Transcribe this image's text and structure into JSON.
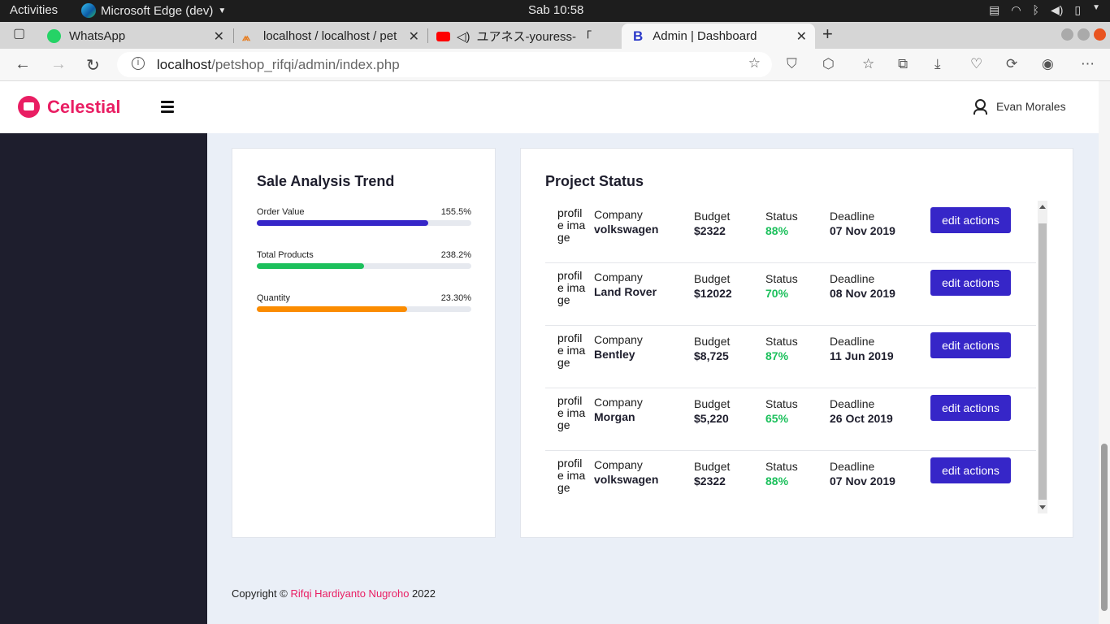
{
  "os": {
    "activities": "Activities",
    "app_name": "Microsoft Edge (dev)",
    "clock": "Sab 10:58"
  },
  "tabs": [
    {
      "title": "WhatsApp",
      "icon": "whatsapp-icon"
    },
    {
      "title": "localhost / localhost / pet",
      "icon": "phpmyadmin-icon"
    },
    {
      "title": "ユアネス-youress- 「",
      "icon": "youtube-icon"
    },
    {
      "title": "Admin | Dashboard",
      "icon": "bootstrap-icon",
      "active": true
    }
  ],
  "address": {
    "host": "localhost",
    "path": "/petshop_rifqi/admin/index.php"
  },
  "header": {
    "brand": "Celestial",
    "user_name": "Evan Morales",
    "brand_color": "#e91e63"
  },
  "sale_analysis": {
    "title": "Sale Analysis Trend",
    "metrics": [
      {
        "label": "Order Value",
        "value": "155.5%",
        "fill": 0.8,
        "color": "#3626c8"
      },
      {
        "label": "Total Products",
        "value": "238.2%",
        "fill": 0.5,
        "color": "#1cc05c"
      },
      {
        "label": "Quantity",
        "value": "23.30%",
        "fill": 0.7,
        "color": "#fb8c00"
      }
    ]
  },
  "project_status": {
    "title": "Project Status",
    "image_alt": "profile image",
    "labels": {
      "company": "Company",
      "budget": "Budget",
      "status": "Status",
      "deadline": "Deadline",
      "action": "edit actions"
    },
    "rows": [
      {
        "company": "volkswagen",
        "budget": "$2322",
        "status": "88%",
        "deadline": "07 Nov 2019"
      },
      {
        "company": "Land Rover",
        "budget": "$12022",
        "status": "70%",
        "deadline": "08 Nov 2019"
      },
      {
        "company": "Bentley",
        "budget": "$8,725",
        "status": "87%",
        "deadline": "11 Jun 2019"
      },
      {
        "company": "Morgan",
        "budget": "$5,220",
        "status": "65%",
        "deadline": "26 Oct 2019"
      },
      {
        "company": "volkswagen",
        "budget": "$2322",
        "status": "88%",
        "deadline": "07 Nov 2019"
      }
    ]
  },
  "footer": {
    "prefix": "Copyright © ",
    "author": "Rifqi Hardiyanto Nugroho",
    "year": " 2022"
  }
}
